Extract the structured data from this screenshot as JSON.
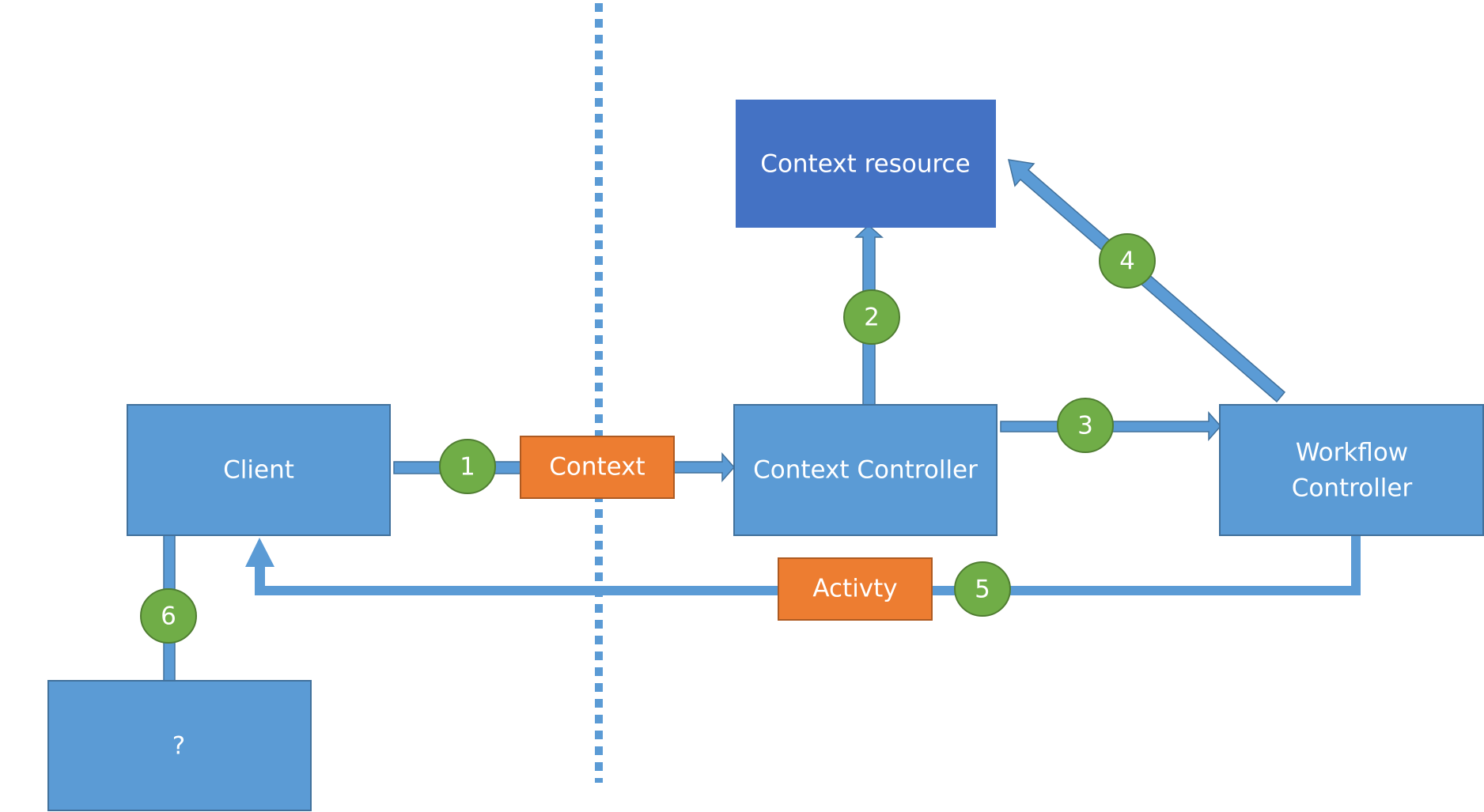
{
  "colors": {
    "box_fill": "#5b9bd5",
    "box_stroke": "#41719c",
    "resource_fill": "#4472c4",
    "message_fill": "#ed7d31",
    "message_stroke": "#ae5a21",
    "step_fill": "#70ad47",
    "step_stroke": "#507e32",
    "arrow_fill": "#5b9bd5",
    "arrow_stroke": "#41719c",
    "divider": "#5b9bd5",
    "text": "#ffffff"
  },
  "nodes": {
    "client": {
      "label": "Client"
    },
    "context_controller": {
      "label": "Context Controller"
    },
    "context_resource": {
      "label": "Context resource"
    },
    "workflow_controller": {
      "label_line1": "Workflow",
      "label_line2": "Controller"
    },
    "unknown": {
      "label": "?"
    }
  },
  "messages": {
    "context": {
      "label": "Context"
    },
    "activity": {
      "label": "Activty"
    }
  },
  "steps": [
    "1",
    "2",
    "3",
    "4",
    "5",
    "6"
  ],
  "divider": {
    "style": "dotted",
    "meaning": "boundary"
  }
}
